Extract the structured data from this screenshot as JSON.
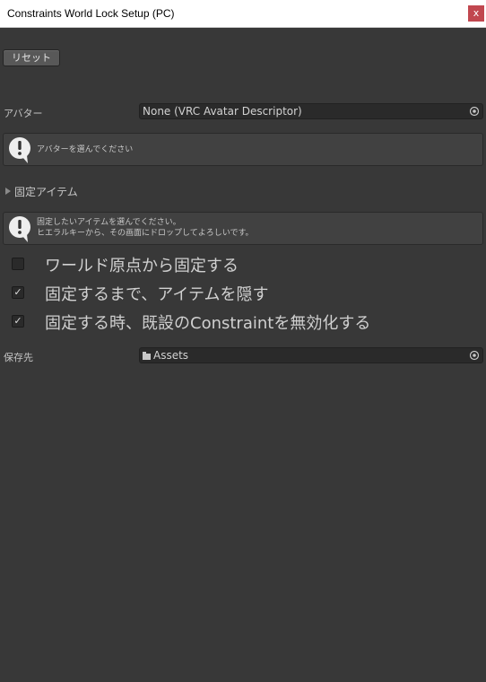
{
  "window": {
    "title": "Constraints World Lock Setup (PC)",
    "close_label": "x"
  },
  "reset": {
    "label": "リセット"
  },
  "avatar": {
    "label": "アバター",
    "value": "None (VRC Avatar Descriptor)"
  },
  "avatar_help": {
    "text": "アバターを選んでください"
  },
  "fixed_items": {
    "label": "固定アイテム"
  },
  "items_help": {
    "line1": "固定したいアイテムを選んでください。",
    "line2": "ヒエラルキーから、その画面にドロップしてよろしいです。"
  },
  "options": [
    {
      "label": "ワールド原点から固定する",
      "checked": false,
      "mark": ""
    },
    {
      "label": "固定するまで、アイテムを隠す",
      "checked": true,
      "mark": "✓"
    },
    {
      "label": "固定する時、既設のConstraintを無効化する",
      "checked": true,
      "mark": "✓"
    }
  ],
  "save_to": {
    "label": "保存先",
    "value": "Assets"
  },
  "colors": {
    "background": "#383838",
    "titlebar": "#ffffff",
    "close_button": "#c1474f",
    "field_bg": "#2a2a2a",
    "helpbox_bg": "#414141"
  }
}
